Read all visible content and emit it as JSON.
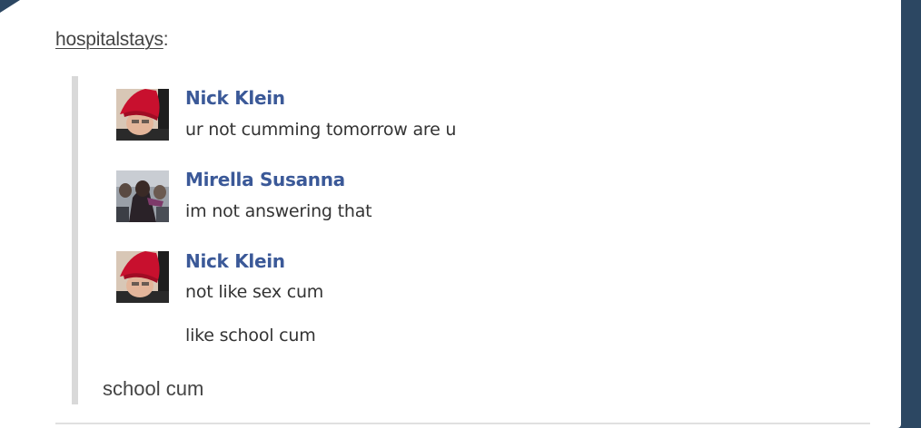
{
  "post": {
    "reblog_source": {
      "username": "hospitalstays",
      "suffix": ":"
    },
    "messages": [
      {
        "author": "Nick Klein",
        "avatar": "red-hat-avatar",
        "lines": [
          "ur not cumming tomorrow are u"
        ]
      },
      {
        "author": "Mirella Susanna",
        "avatar": "group-photo-avatar",
        "lines": [
          "im not answering that"
        ]
      },
      {
        "author": "Nick Klein",
        "avatar": "red-hat-avatar",
        "lines": [
          "not like sex cum",
          "like school cum"
        ]
      }
    ],
    "reblog_comment": "school cum"
  },
  "theme": {
    "background": "#2c4762",
    "card": "#ffffff",
    "name_color": "#3b5998",
    "quote_bar": "#d9d9d9"
  }
}
